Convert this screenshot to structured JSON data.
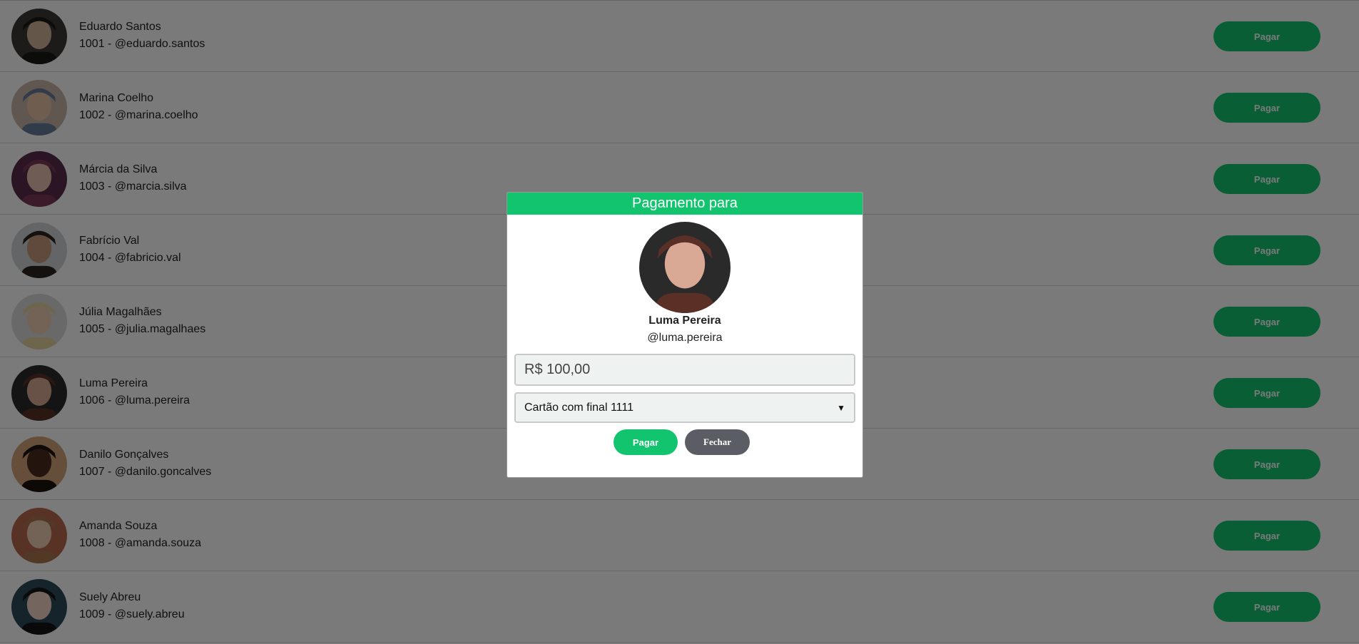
{
  "users": [
    {
      "name": "Eduardo Santos",
      "handle": "1001 - @eduardo.santos",
      "pay_label": "Pagar",
      "avatar_colors": [
        "#3b3a38",
        "#d4b49c",
        "#1a1918"
      ]
    },
    {
      "name": "Marina Coelho",
      "handle": "1002 - @marina.coelho",
      "pay_label": "Pagar",
      "avatar_colors": [
        "#c9b9a8",
        "#e8c4a8",
        "#6a7c9c"
      ]
    },
    {
      "name": "Márcia da Silva",
      "handle": "1003 - @marcia.silva",
      "pay_label": "Pagar",
      "avatar_colors": [
        "#5a2c4c",
        "#e9c3b2",
        "#7b3a58"
      ]
    },
    {
      "name": "Fabrício Val",
      "handle": "1004 - @fabricio.val",
      "pay_label": "Pagar",
      "avatar_colors": [
        "#cfd3d6",
        "#c89b7b",
        "#2b2520"
      ]
    },
    {
      "name": "Júlia Magalhães",
      "handle": "1005 - @julia.magalhaes",
      "pay_label": "Pagar",
      "avatar_colors": [
        "#dcdcdc",
        "#f0cfb4",
        "#e3d6a0"
      ]
    },
    {
      "name": "Luma Pereira",
      "handle": "1006 - @luma.pereira",
      "pay_label": "Pagar",
      "avatar_colors": [
        "#2a2a2a",
        "#d9a995",
        "#5a3026"
      ]
    },
    {
      "name": "Danilo Gonçalves",
      "handle": "1007 - @danilo.goncalves",
      "pay_label": "Pagar",
      "avatar_colors": [
        "#d4a37a",
        "#4a2d1f",
        "#1b1410"
      ]
    },
    {
      "name": "Amanda Souza",
      "handle": "1008 - @amanda.souza",
      "pay_label": "Pagar",
      "avatar_colors": [
        "#b96a4e",
        "#f1cdb5",
        "#a9784f"
      ]
    },
    {
      "name": "Suely Abreu",
      "handle": "1009 - @suely.abreu",
      "pay_label": "Pagar",
      "avatar_colors": [
        "#2c4a5a",
        "#f3d3c4",
        "#141414"
      ]
    }
  ],
  "modal": {
    "title": "Pagamento para",
    "name": "Luma Pereira",
    "handle": "@luma.pereira",
    "amount_value": "R$ 100,00",
    "card_selected": "Cartão com final 1111",
    "pay_label": "Pagar",
    "close_label": "Fechar",
    "avatar_colors": [
      "#2a2a2a",
      "#d9a995",
      "#5a3026"
    ]
  },
  "colors": {
    "accent": "#13c46f",
    "close_button": "#5a5d63"
  }
}
